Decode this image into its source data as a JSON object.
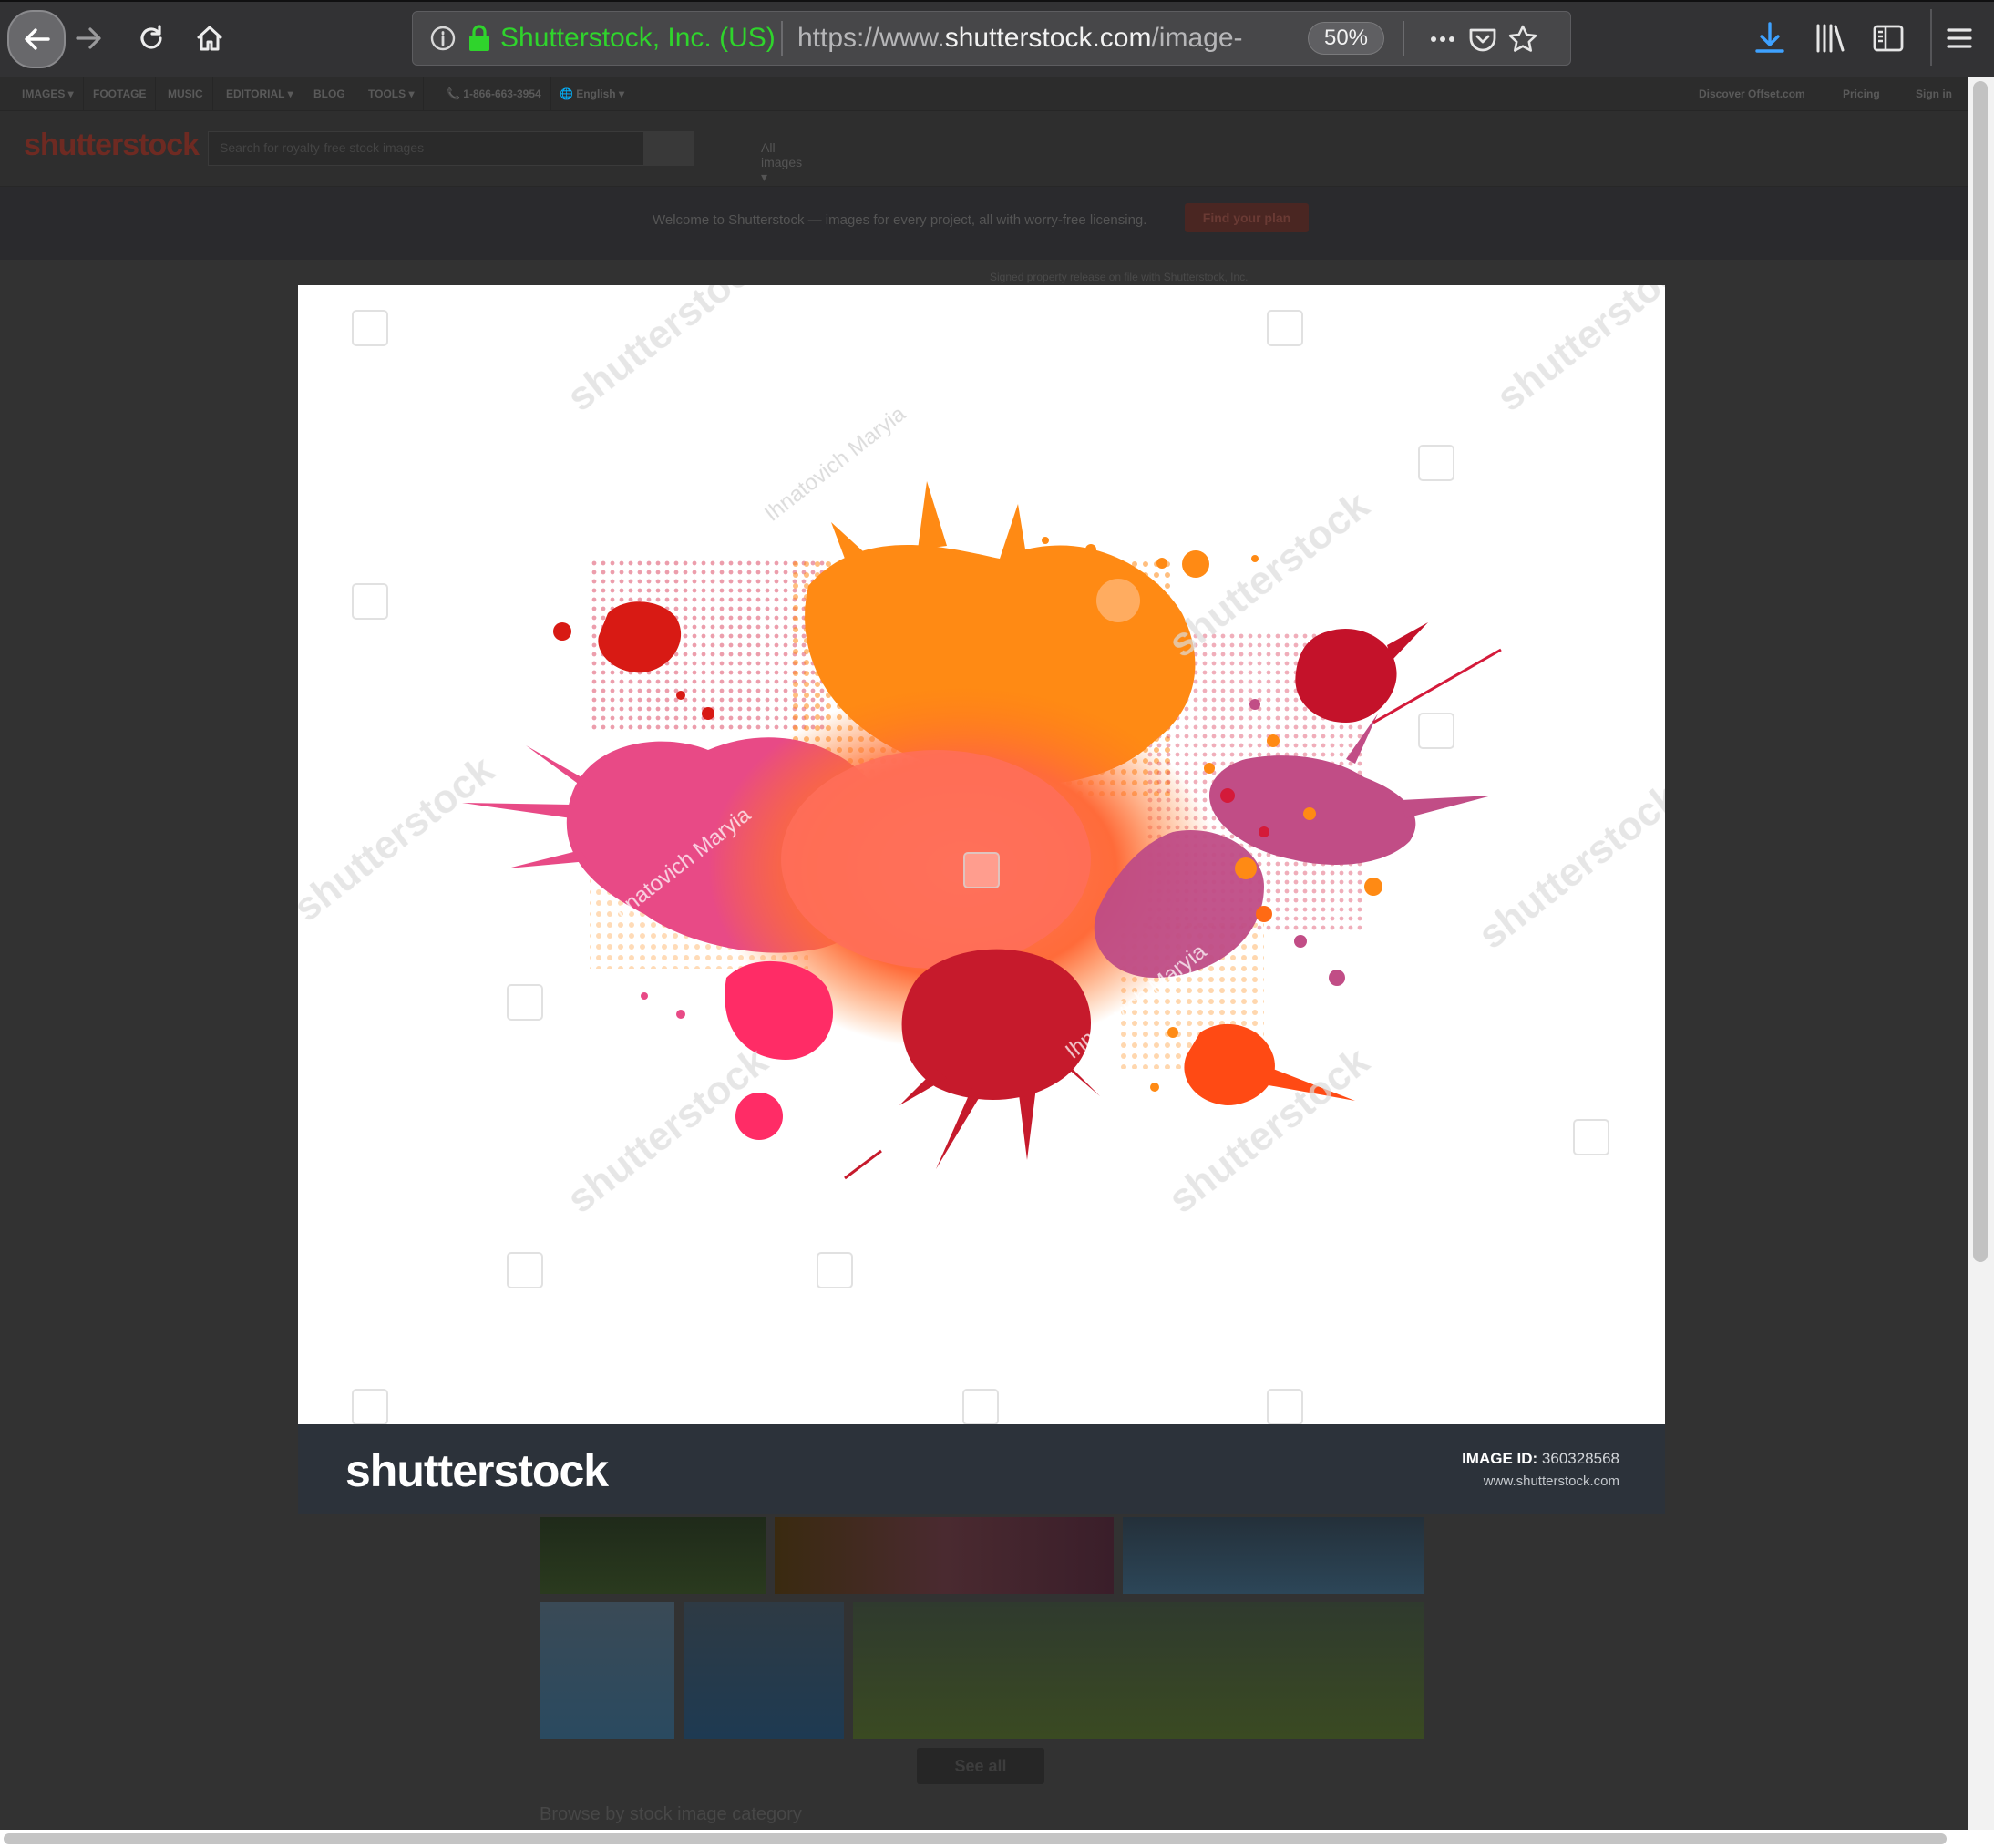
{
  "browser": {
    "site_identity": "Shutterstock, Inc. (US)",
    "url_prefix": "https://www.",
    "url_domain": "shutterstock.com",
    "url_path": "/image-",
    "zoom": "50%",
    "icons": [
      "back-arrow-icon",
      "forward-arrow-icon",
      "reload-icon",
      "home-icon",
      "info-icon",
      "lock-icon",
      "page-actions-icon",
      "pocket-icon",
      "bookmark-star-icon",
      "download-icon",
      "library-icon",
      "sidebar-icon",
      "menu-icon"
    ],
    "accent_green": "#2fd42c",
    "download_blue": "#3ea1ff"
  },
  "background_page": {
    "top_nav": [
      "IMAGES ▾",
      "FOOTAGE",
      "MUSIC",
      "EDITORIAL ▾",
      "BLOG",
      "TOOLS ▾",
      "📞 1-866-663-3954",
      "🌐 English ▾"
    ],
    "top_nav_right": [
      "Discover Offset.com",
      "Pricing",
      "Sign in"
    ],
    "logo": "shutterstock",
    "search_placeholder": "Search for royalty-free stock images",
    "search_category": "All images ▾",
    "banner_text": "Welcome to Shutterstock — images for every project, all with worry-free licensing.",
    "banner_button": "Find your plan",
    "release_note": "Signed property release on file with Shutterstock, Inc.",
    "see_all": "See all",
    "browse_label": "Browse by stock image category"
  },
  "lightbox": {
    "footer_logo": "shutterstock",
    "image_id_label": "IMAGE ID:",
    "image_id": "360328568",
    "footer_url": "www.shutterstock.com",
    "watermark_brand": "shutterstock",
    "watermark_author": "Ihnatovich Maryia"
  }
}
